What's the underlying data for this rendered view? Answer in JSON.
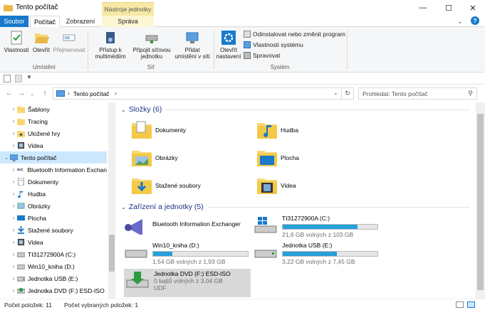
{
  "window": {
    "title": "Tento počítač"
  },
  "tabs": {
    "file": "Soubor",
    "home": "Počítač",
    "view": "Zobrazení",
    "context_header": "Nástroje jednotky",
    "manage": "Správa"
  },
  "ribbon": {
    "properties": "Vlastnosti",
    "open": "Otevřít",
    "rename": "Přejmenovat",
    "group_location": "Umístění",
    "access_media": "Přístup k\nmultimédiím",
    "map_drive": "Připojit síťovou\njednotku",
    "add_location": "Přidat\numístění v síti",
    "group_network": "Síť",
    "open_settings": "Otevřít\nnastavení",
    "uninstall": "Odinstalovat nebo změnit program",
    "system_props": "Vlastnosti systému",
    "manage": "Spravovat",
    "group_system": "Systém"
  },
  "address": {
    "path": "Tento počítač",
    "search_placeholder": "Prohledat: Tento počítač"
  },
  "nav": [
    {
      "label": "Šablony",
      "icon": "folder-icon",
      "indent": 1,
      "chev": "›"
    },
    {
      "label": "Tracing",
      "icon": "folder-icon",
      "indent": 1,
      "chev": "›"
    },
    {
      "label": "Uložené hry",
      "icon": "saved-games-icon",
      "indent": 1,
      "chev": "›"
    },
    {
      "label": "Videa",
      "icon": "video-folder-icon",
      "indent": 1,
      "chev": "›"
    },
    {
      "label": "Tento počítač",
      "icon": "this-pc-icon",
      "indent": 0,
      "chev": "⌄",
      "selected": true
    },
    {
      "label": "Bluetooth Information Exchan",
      "icon": "bluetooth-icon",
      "indent": 1,
      "chev": "›"
    },
    {
      "label": "Dokumenty",
      "icon": "documents-icon",
      "indent": 1,
      "chev": "›"
    },
    {
      "label": "Hudba",
      "icon": "music-icon",
      "indent": 1,
      "chev": "›"
    },
    {
      "label": "Obrázky",
      "icon": "pictures-icon",
      "indent": 1,
      "chev": "›"
    },
    {
      "label": "Plocha",
      "icon": "desktop-icon",
      "indent": 1,
      "chev": "›"
    },
    {
      "label": "Stažené soubory",
      "icon": "downloads-icon",
      "indent": 1,
      "chev": "›"
    },
    {
      "label": "Videa",
      "icon": "video-folder-icon",
      "indent": 1,
      "chev": "›"
    },
    {
      "label": "TI31272900A (C:)",
      "icon": "drive-icon",
      "indent": 1,
      "chev": "›"
    },
    {
      "label": "Win10_kniha (D:)",
      "icon": "drive-icon",
      "indent": 1,
      "chev": "›"
    },
    {
      "label": "Jednotka USB (E:)",
      "icon": "usb-drive-icon",
      "indent": 1,
      "chev": "›"
    },
    {
      "label": "Jednotka DVD (F:) ESD-ISO",
      "icon": "dvd-drive-icon",
      "indent": 1,
      "chev": "›"
    }
  ],
  "folders_header": "Složky (6)",
  "folders": [
    {
      "label": "Dokumenty",
      "icon": "documents-folder-icon"
    },
    {
      "label": "Hudba",
      "icon": "music-folder-icon"
    },
    {
      "label": "Obrázky",
      "icon": "pictures-folder-icon"
    },
    {
      "label": "Plocha",
      "icon": "desktop-folder-icon"
    },
    {
      "label": "Stažené soubory",
      "icon": "downloads-folder-icon"
    },
    {
      "label": "Videa",
      "icon": "videos-folder-icon"
    }
  ],
  "devices_header": "Zařízení a jednotky (5)",
  "devices": [
    {
      "label": "Bluetooth Information Exchanger",
      "icon": "bluetooth-exchanger-icon"
    },
    {
      "label": "TI31272900A (C:)",
      "sub": "21,6 GB volných z 103 GB",
      "used": 0.79,
      "icon": "windows-drive-icon"
    },
    {
      "label": "Win10_kniha (D:)",
      "sub": "1,54 GB volných z 1,93 GB",
      "used": 0.2,
      "icon": "drive-icon"
    },
    {
      "label": "Jednotka USB (E:)",
      "sub": "3,22 GB volných z 7,45 GB",
      "used": 0.57,
      "icon": "usb-drive-icon"
    },
    {
      "label": "Jednotka DVD (F:) ESD-ISO",
      "sub": "0 bajtů volných z 3,04 GB",
      "sub2": "UDF",
      "icon": "dvd-drive-icon",
      "selected": true
    }
  ],
  "status": {
    "items": "Počet položek: 11",
    "selected": "Počet vybraných položek: 1"
  },
  "colors": {
    "accent": "#1979ca",
    "bar": "#26a0da",
    "selection": "#cce8ff",
    "folder": "#f8d775"
  }
}
